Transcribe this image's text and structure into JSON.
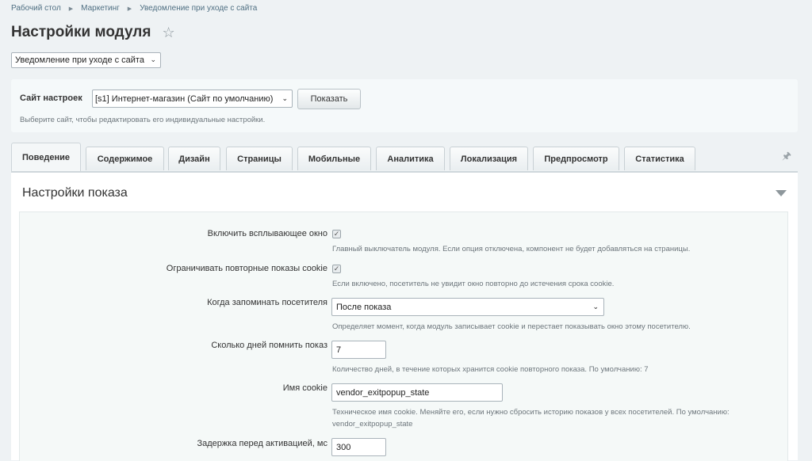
{
  "breadcrumb": [
    "Рабочий стол",
    "Маркетинг",
    "Уведомление при уходе с сайта"
  ],
  "page_title": "Настройки модуля",
  "module_select": "Уведомление при уходе с сайта",
  "site": {
    "label": "Сайт настроек",
    "selected": "[s1] Интернет-магазин (Сайт по умолчанию)",
    "button": "Показать",
    "hint": "Выберите сайт, чтобы редактировать его индивидуальные настройки."
  },
  "tabs": [
    "Поведение",
    "Содержимое",
    "Дизайн",
    "Страницы",
    "Мобильные",
    "Аналитика",
    "Локализация",
    "Предпросмотр",
    "Статистика"
  ],
  "section_title": "Настройки показа",
  "fields": {
    "enable_popup": {
      "label": "Включить всплывающее окно",
      "checked": true,
      "hint": "Главный выключатель модуля. Если опция отключена, компонент не будет добавляться на страницы."
    },
    "limit_cookie": {
      "label": "Ограничивать повторные показы cookie",
      "checked": true,
      "hint": "Если включено, посетитель не увидит окно повторно до истечения срока cookie."
    },
    "remember_when": {
      "label": "Когда запоминать посетителя",
      "value": "После показа",
      "hint": "Определяет момент, когда модуль записывает cookie и перестает показывать окно этому посетителю."
    },
    "days": {
      "label": "Сколько дней помнить показ",
      "value": "7",
      "hint": "Количество дней, в течение которых хранится cookie повторного показа. По умолчанию: 7"
    },
    "cookie_name": {
      "label": "Имя cookie",
      "value": "vendor_exitpopup_state",
      "hint": "Техническое имя cookie. Меняйте его, если нужно сбросить историю показов у всех посетителей. По умолчанию: vendor_exitpopup_state"
    },
    "delay": {
      "label": "Задержка перед активацией, мс",
      "value": "300"
    }
  },
  "icons": {
    "favorite": "star-icon",
    "pin": "pin-icon",
    "collapse": "triangle-down-icon"
  }
}
